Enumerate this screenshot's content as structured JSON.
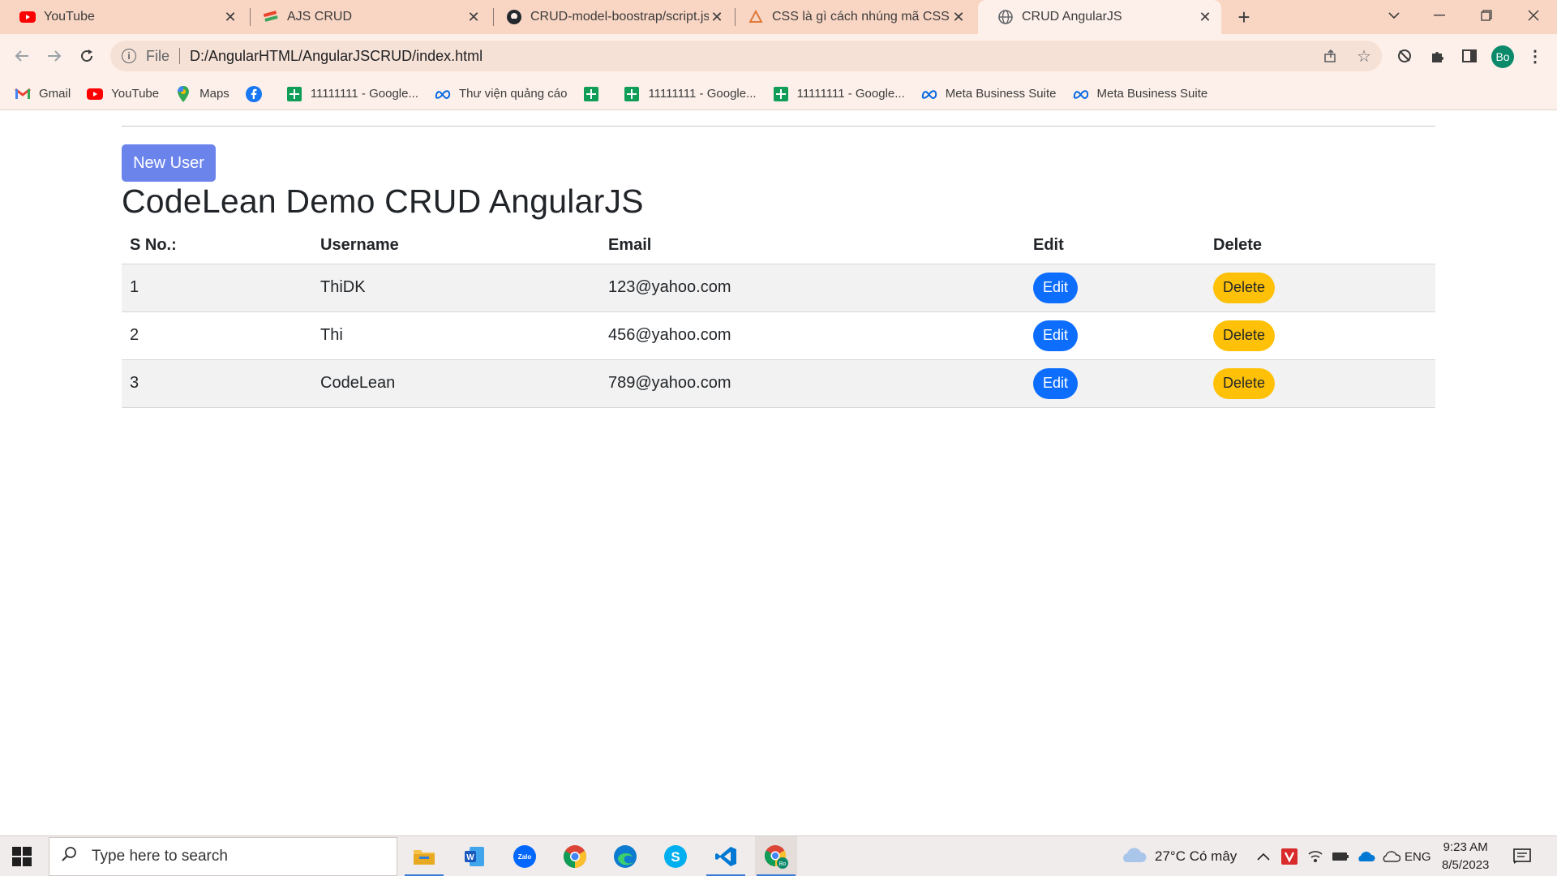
{
  "browser": {
    "tabs": [
      {
        "title": "YouTube",
        "icon": "youtube-icon"
      },
      {
        "title": "AJS CRUD",
        "icon": "ajs-logo-icon"
      },
      {
        "title": "CRUD-model-boostrap/script.js a",
        "icon": "github-icon"
      },
      {
        "title": "CSS là gì cách nhúng mã CSS vào",
        "icon": "css-site-icon"
      },
      {
        "title": "CRUD AngularJS",
        "icon": "globe-icon",
        "active": true
      }
    ],
    "address": {
      "scheme": "File",
      "url": "D:/AngularHTML/AngularJSCRUD/index.html"
    },
    "profile_initials": "Bo",
    "bookmarks": [
      {
        "label": "Gmail",
        "icon": "gmail-icon"
      },
      {
        "label": "YouTube",
        "icon": "youtube-icon"
      },
      {
        "label": "Maps",
        "icon": "maps-icon"
      },
      {
        "label": "",
        "icon": "facebook-icon"
      },
      {
        "label": "11111111 - Google...",
        "icon": "sheets-icon"
      },
      {
        "label": "Thư viện quảng cáo",
        "icon": "meta-icon"
      },
      {
        "label": "",
        "icon": "sheets-icon"
      },
      {
        "label": "11111111 - Google...",
        "icon": "sheets-icon"
      },
      {
        "label": "11111111 - Google...",
        "icon": "sheets-icon"
      },
      {
        "label": "Meta Business Suite",
        "icon": "meta-icon"
      },
      {
        "label": "Meta Business Suite",
        "icon": "meta-icon"
      }
    ]
  },
  "page": {
    "new_user_label": "New User",
    "title": "CodeLean Demo CRUD AngularJS",
    "table": {
      "headers": [
        "S No.:",
        "Username",
        "Email",
        "Edit",
        "Delete"
      ],
      "rows": [
        {
          "sno": "1",
          "username": "ThiDK",
          "email": "123@yahoo.com",
          "edit": "Edit",
          "delete": "Delete"
        },
        {
          "sno": "2",
          "username": "Thi",
          "email": "456@yahoo.com",
          "edit": "Edit",
          "delete": "Delete"
        },
        {
          "sno": "3",
          "username": "CodeLean",
          "email": "789@yahoo.com",
          "edit": "Edit",
          "delete": "Delete"
        }
      ]
    }
  },
  "taskbar": {
    "search_placeholder": "Type here to search",
    "weather": "27°C  Có mây",
    "language": "ENG",
    "time": "9:23 AM",
    "date": "8/5/2023"
  },
  "colors": {
    "primary_button": "#0d6efd",
    "warning_button": "#ffc107",
    "new_user_button": "#6b84ec",
    "tabstrip": "#f9d6c4"
  }
}
